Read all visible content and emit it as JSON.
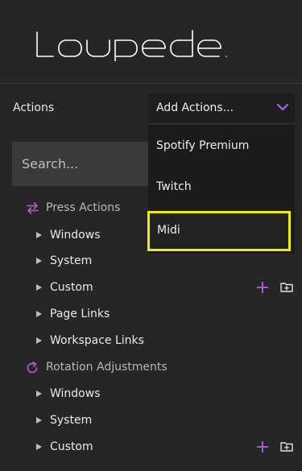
{
  "brand": {
    "logo_text": "Loupedeck"
  },
  "actions": {
    "label": "Actions",
    "dropdown_value": "Add Actions...",
    "dropdown_options": [
      "Spotify Premium",
      "Twitch",
      "Midi"
    ],
    "highlighted_option": "Midi"
  },
  "search": {
    "placeholder": "Search..."
  },
  "press_actions": {
    "title": "Press Actions",
    "items": [
      "Windows",
      "System",
      "Custom",
      "Page Links",
      "Workspace Links"
    ]
  },
  "rotation_adjustments": {
    "title": "Rotation Adjustments",
    "items": [
      "Windows",
      "System",
      "Custom"
    ]
  },
  "colors": {
    "accent": "#a25bd6",
    "highlight": "#f2ec00",
    "background": "#262626"
  }
}
